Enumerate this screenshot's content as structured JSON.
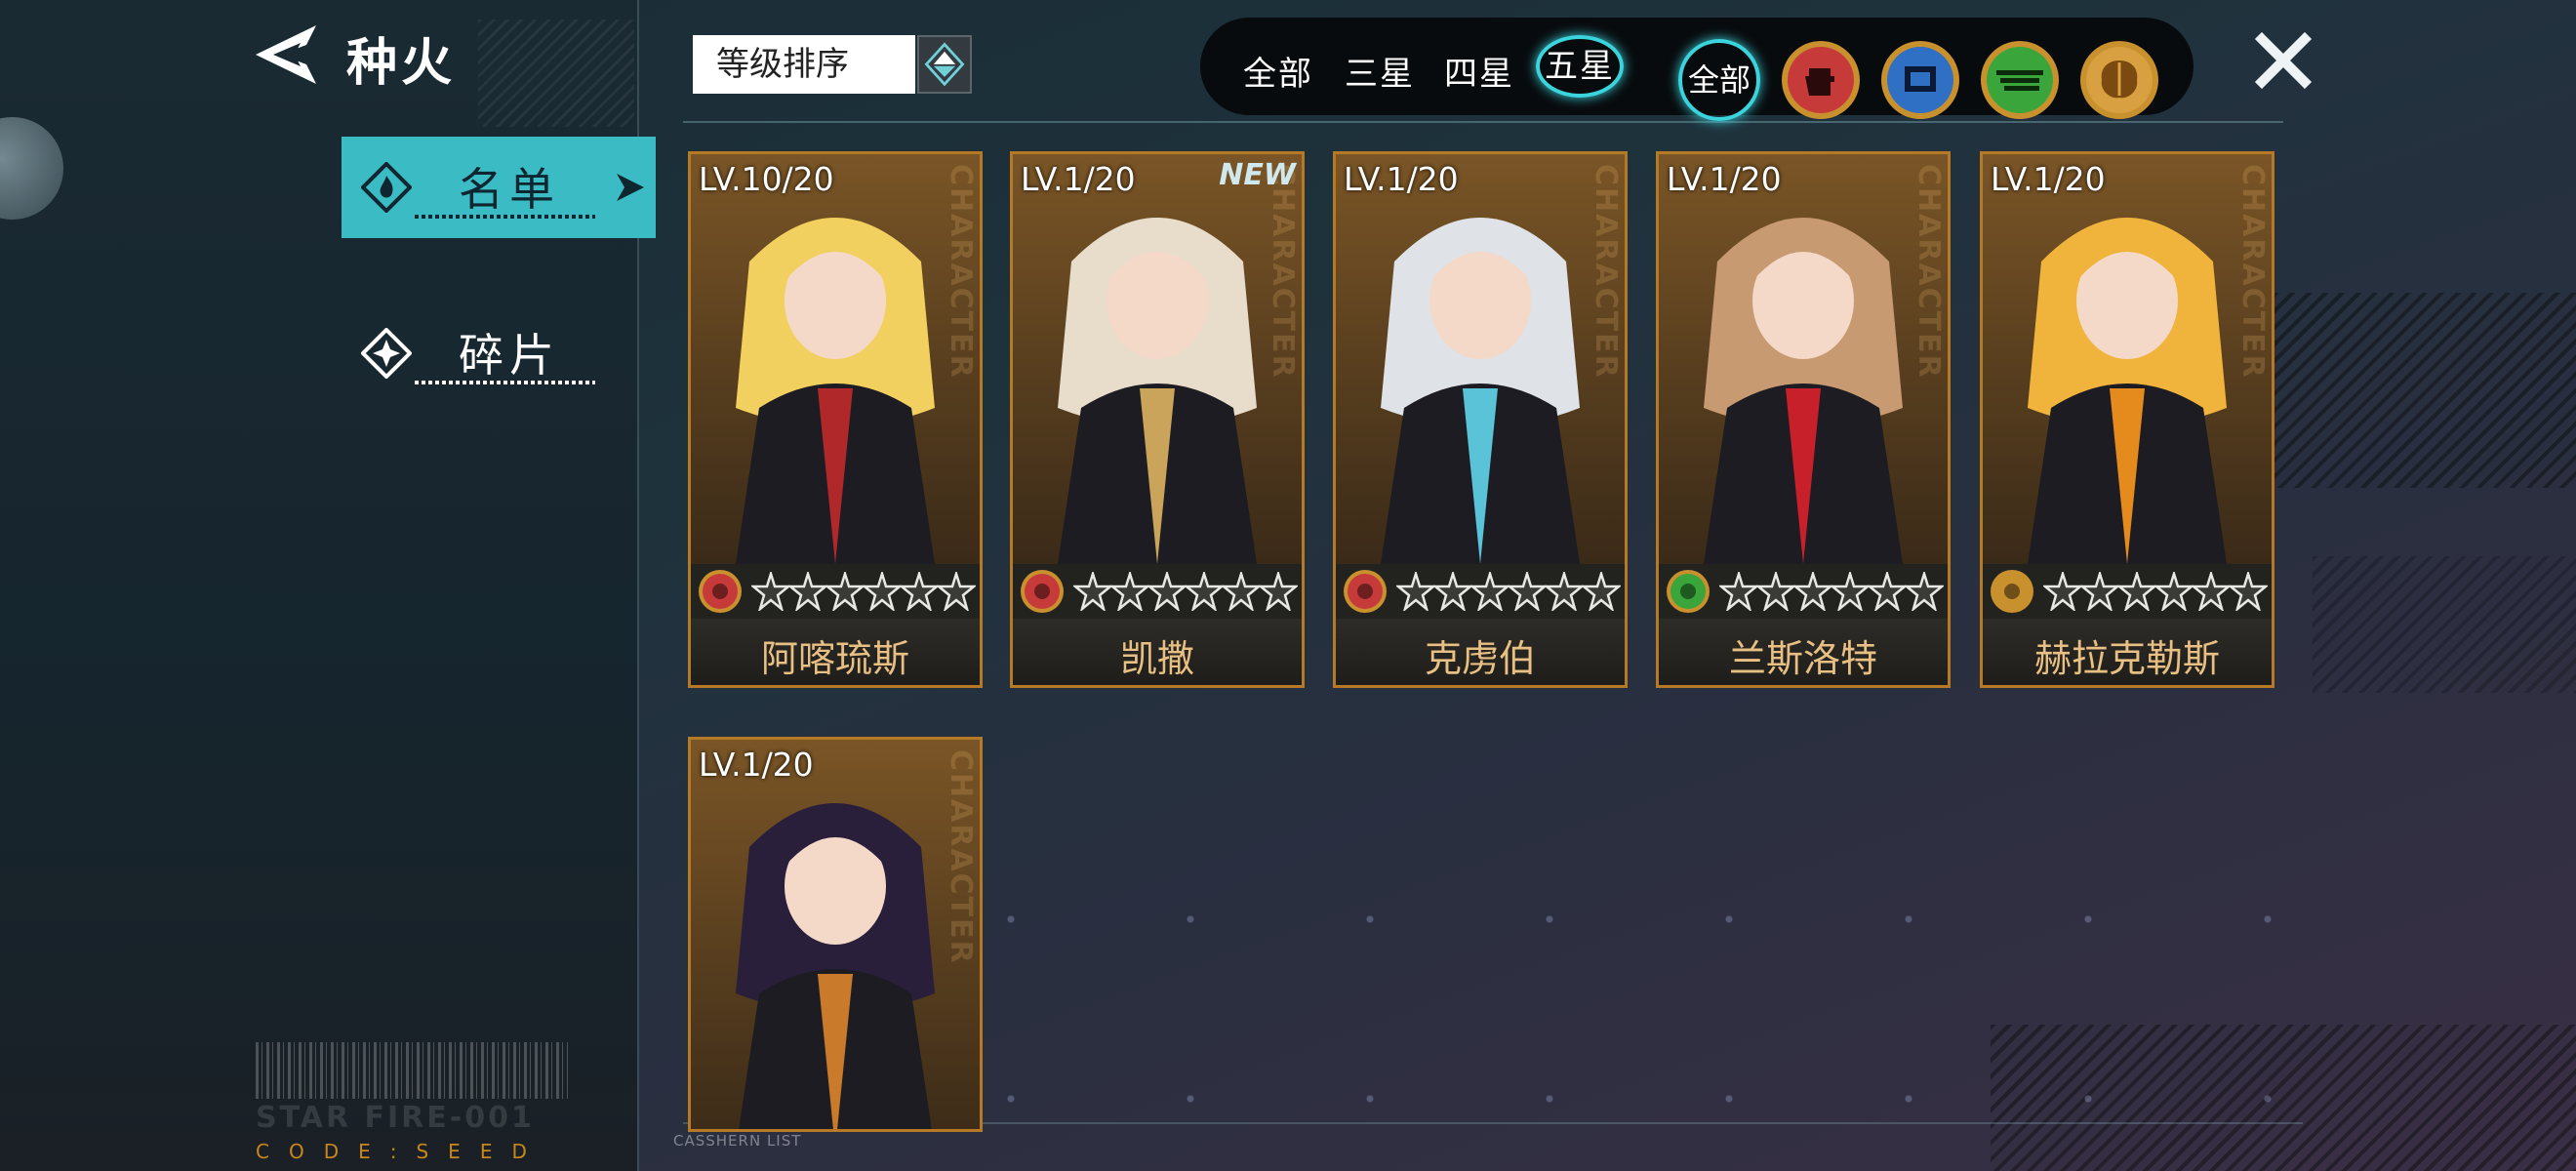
{
  "header": {
    "title": "种火"
  },
  "nav": [
    {
      "label": "名单",
      "active": true
    },
    {
      "label": "碎片",
      "active": false
    }
  ],
  "sort": {
    "label": "等级排序"
  },
  "star_filters": [
    {
      "label": "全部",
      "active": false
    },
    {
      "label": "三星",
      "active": false
    },
    {
      "label": "四星",
      "active": false
    },
    {
      "label": "五星",
      "active": true
    }
  ],
  "type_filters": [
    {
      "label": "全部",
      "icon": "all",
      "active": true
    },
    {
      "icon": "fist-icon",
      "color": "#c73a3a"
    },
    {
      "icon": "chip-icon",
      "color": "#2f6fc4"
    },
    {
      "icon": "speed-icon",
      "color": "#3aa53a"
    },
    {
      "icon": "brain-icon",
      "color": "#c9902e"
    }
  ],
  "cards": [
    {
      "level": "LV.10/20",
      "name": "阿喀琉斯",
      "type_icon": "fist-icon",
      "type_color": "#c73a3a",
      "new": "",
      "hair": "#f2d060",
      "accent": "#b0282a"
    },
    {
      "level": "LV.1/20",
      "name": "凯撒",
      "type_icon": "fist-icon",
      "type_color": "#c73a3a",
      "new": "NEW",
      "hair": "#e8dccb",
      "accent": "#c9a45a"
    },
    {
      "level": "LV.1/20",
      "name": "克虏伯",
      "type_icon": "fist-icon",
      "type_color": "#c73a3a",
      "new": "",
      "hair": "#dfe2e6",
      "accent": "#5ac3d8"
    },
    {
      "level": "LV.1/20",
      "name": "兰斯洛特",
      "type_icon": "speed-icon",
      "type_color": "#3aa53a",
      "new": "",
      "hair": "#c79a72",
      "accent": "#c8202a"
    },
    {
      "level": "LV.1/20",
      "name": "赫拉克勒斯",
      "type_icon": "brain-icon",
      "type_color": "#c9902e",
      "new": "",
      "hair": "#f0b43c",
      "accent": "#e58a1c"
    },
    {
      "level": "LV.1/20",
      "name": "",
      "type_icon": "",
      "type_color": "",
      "new": "",
      "hair": "#2a1f3a",
      "accent": "#c97a2a"
    }
  ],
  "card_vertical_text": "CHARACTER",
  "footer": {
    "brand": "STAR FIRE-001",
    "code": "CODE:SEED",
    "list_tag": "CASSHERN LIST"
  }
}
